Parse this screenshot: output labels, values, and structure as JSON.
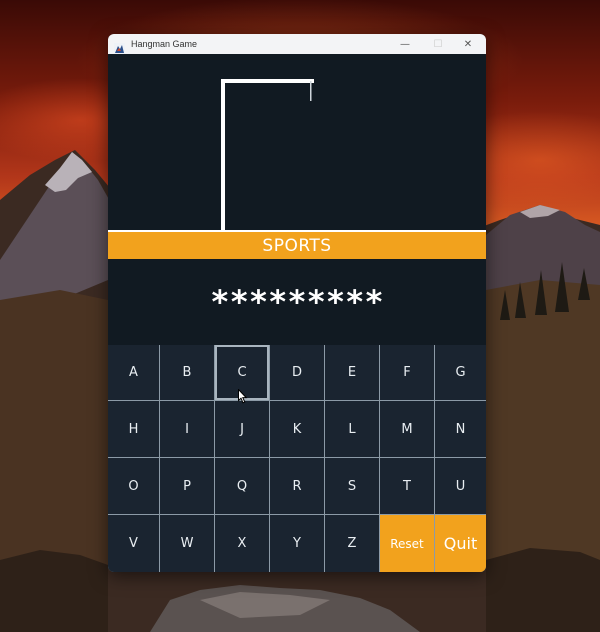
{
  "window": {
    "title": "Hangman Game",
    "controls": {
      "minimize": "—",
      "maximize": "☐",
      "close": "✕"
    }
  },
  "category": "SPORTS",
  "masked_word": "*********",
  "keyboard": {
    "letters": [
      "A",
      "B",
      "C",
      "D",
      "E",
      "F",
      "G",
      "H",
      "I",
      "J",
      "K",
      "L",
      "M",
      "N",
      "O",
      "P",
      "Q",
      "R",
      "S",
      "T",
      "U",
      "V",
      "W",
      "X",
      "Y",
      "Z"
    ],
    "hovered_letter": "C",
    "reset_label": "Reset",
    "quit_label": "Quit"
  },
  "colors": {
    "background": "#111a22",
    "key_background": "#1a2430",
    "accent": "#f2a21d",
    "grid_lines": "#8c9aa6",
    "text": "#ffffff"
  },
  "icons": {
    "app": "tk-feather-icon",
    "cursor": "mouse-pointer-icon"
  }
}
